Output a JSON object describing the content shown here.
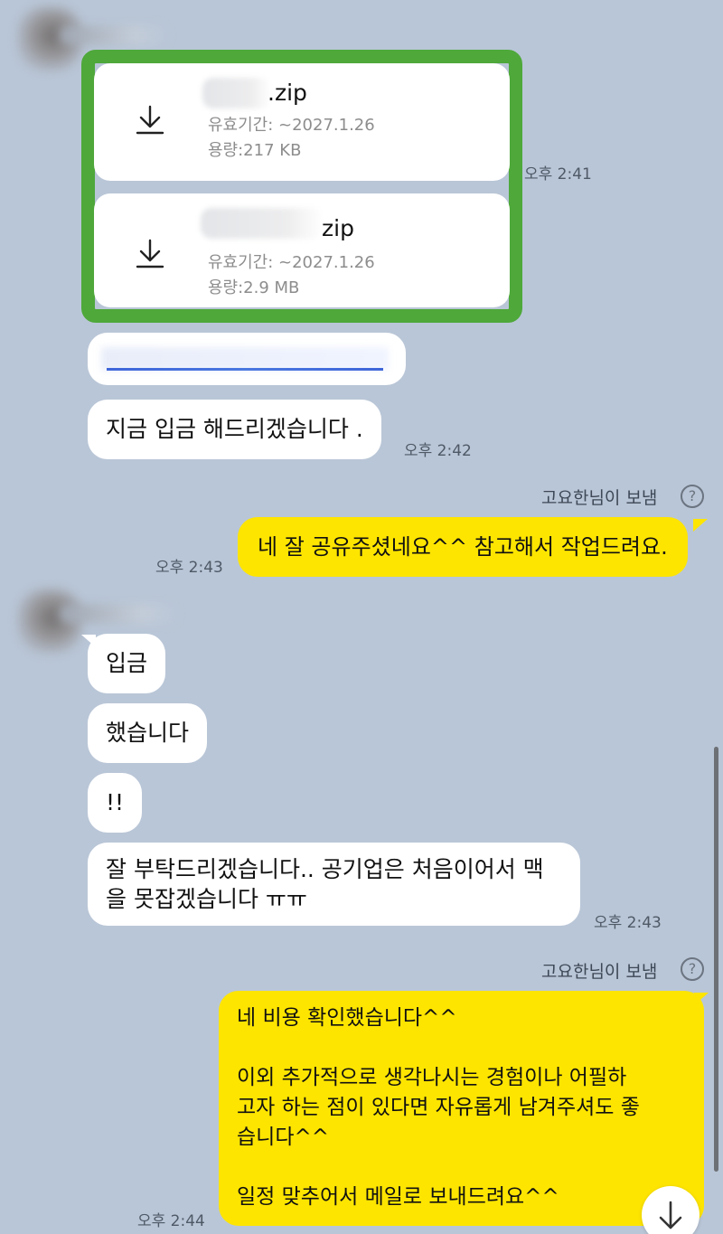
{
  "messages": {
    "file1": {
      "name": ".zip",
      "expiry": "유효기간: ~2027.1.26",
      "size": "용량:217 KB"
    },
    "file2": {
      "name": "zip",
      "expiry": "유효기간: ~2027.1.26",
      "size": "용량:2.9 MB"
    },
    "time_241": "오후 2:41",
    "deposit_msg": "지금 입금 해드리겠습니다 .",
    "time_242": "오후 2:42",
    "sent_by_1": "고요한님이 보냄",
    "my_msg_1": "네 잘 공유주셨네요^^ 참고해서 작업드려요.",
    "time_243a": "오후 2:43",
    "b_deposit": "입금",
    "b_done": "했습니다",
    "b_excl": "!!",
    "b_please_line1": "잘 부탁드리겠습니다.. 공기업은 처음이어서 맥",
    "b_please_line2": "을 못잡겠습니다 ㅠㅠ",
    "time_243b": "오후 2:43",
    "sent_by_2": "고요한님이 보냄",
    "my_msg_2": {
      "line1": "네 비용 확인했습니다^^",
      "line2": "이외 추가적으로 생각나시는 경험이나 어필하",
      "line3": "고자 하는 점이 있다면 자유롭게 남겨주셔도 좋",
      "line4": "습니다^^",
      "line5": "일정 맞추어서 메일로 보내드려요^^"
    },
    "time_244": "오후 2:44",
    "help_glyph": "?"
  },
  "colors": {
    "background": "#b9c6d7",
    "my_bubble": "#fee500",
    "other_bubble": "#ffffff",
    "highlight_border": "#4ea83a",
    "link": "#3f66d9"
  },
  "icons": [
    "download-icon",
    "download-icon",
    "help-icon",
    "arrow-down-icon"
  ]
}
